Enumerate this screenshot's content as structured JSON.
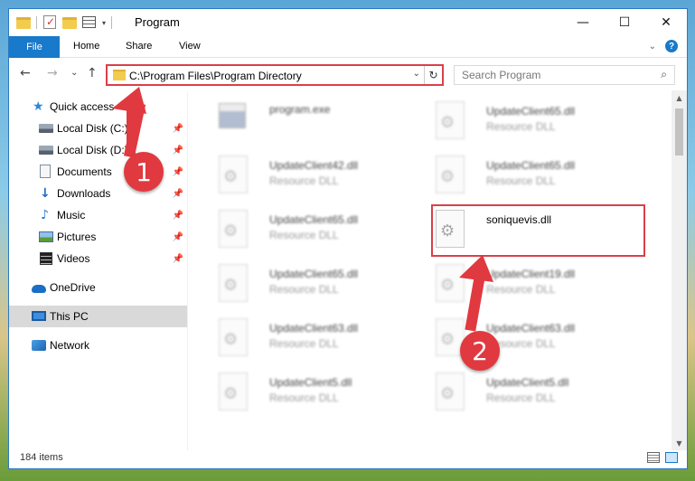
{
  "window": {
    "title": "Program",
    "buttons": {
      "minimize": "—",
      "maximize": "☐",
      "close": "✕"
    }
  },
  "ribbon": {
    "tabs": [
      "File",
      "Home",
      "Share",
      "View"
    ],
    "help": "?"
  },
  "nav": {
    "back": "←",
    "forward": "→",
    "recent": "⌄",
    "up": "↑",
    "address": "C:\\Program Files\\Program Directory",
    "refresh": "↻",
    "search_placeholder": "Search Program",
    "search_icon": "search-icon"
  },
  "sidebar": {
    "items": [
      {
        "label": "Quick access",
        "icon": "star-icon"
      },
      {
        "label": "Local Disk (C:)",
        "icon": "disk-icon",
        "pinned": true
      },
      {
        "label": "Local Disk (D:)",
        "icon": "disk-icon",
        "pinned": true
      },
      {
        "label": "Documents",
        "icon": "documents-icon",
        "pinned": true
      },
      {
        "label": "Downloads",
        "icon": "downloads-icon",
        "pinned": true
      },
      {
        "label": "Music",
        "icon": "music-icon",
        "pinned": true
      },
      {
        "label": "Pictures",
        "icon": "pictures-icon",
        "pinned": true
      },
      {
        "label": "Videos",
        "icon": "videos-icon",
        "pinned": true
      },
      {
        "label": "OneDrive",
        "icon": "onedrive-icon"
      },
      {
        "label": "This PC",
        "icon": "pc-icon",
        "selected": true
      },
      {
        "label": "Network",
        "icon": "network-icon"
      }
    ]
  },
  "files": [
    {
      "name": "program.exe",
      "type": ""
    },
    {
      "name": "UpdateClient65.dll",
      "type": "Resource DLL"
    },
    {
      "name": "UpdateClient42.dll",
      "type": "Resource DLL"
    },
    {
      "name": "UpdateClient65.dll",
      "type": "Resource DLL"
    },
    {
      "name": "UpdateClient65.dll",
      "type": "Resource DLL"
    },
    {
      "name": "soniquevis.dll",
      "type": ""
    },
    {
      "name": "UpdateClient65.dll",
      "type": "Resource DLL"
    },
    {
      "name": "UpdateClient19.dll",
      "type": "Resource DLL"
    },
    {
      "name": "UpdateClient63.dll",
      "type": "Resource DLL"
    },
    {
      "name": "UpdateClient63.dll",
      "type": "Resource DLL"
    },
    {
      "name": "UpdateClient5.dll",
      "type": "Resource DLL"
    },
    {
      "name": "UpdateClient5.dll",
      "type": "Resource DLL"
    }
  ],
  "status": {
    "items_count": "184 items"
  },
  "annotations": {
    "step1": "1",
    "step2": "2",
    "accent_color": "#e0393f",
    "highlight_color": "#d9404a"
  },
  "colors": {
    "file_tab": "#1979ca",
    "selected_nav": "#d9d9d9"
  }
}
